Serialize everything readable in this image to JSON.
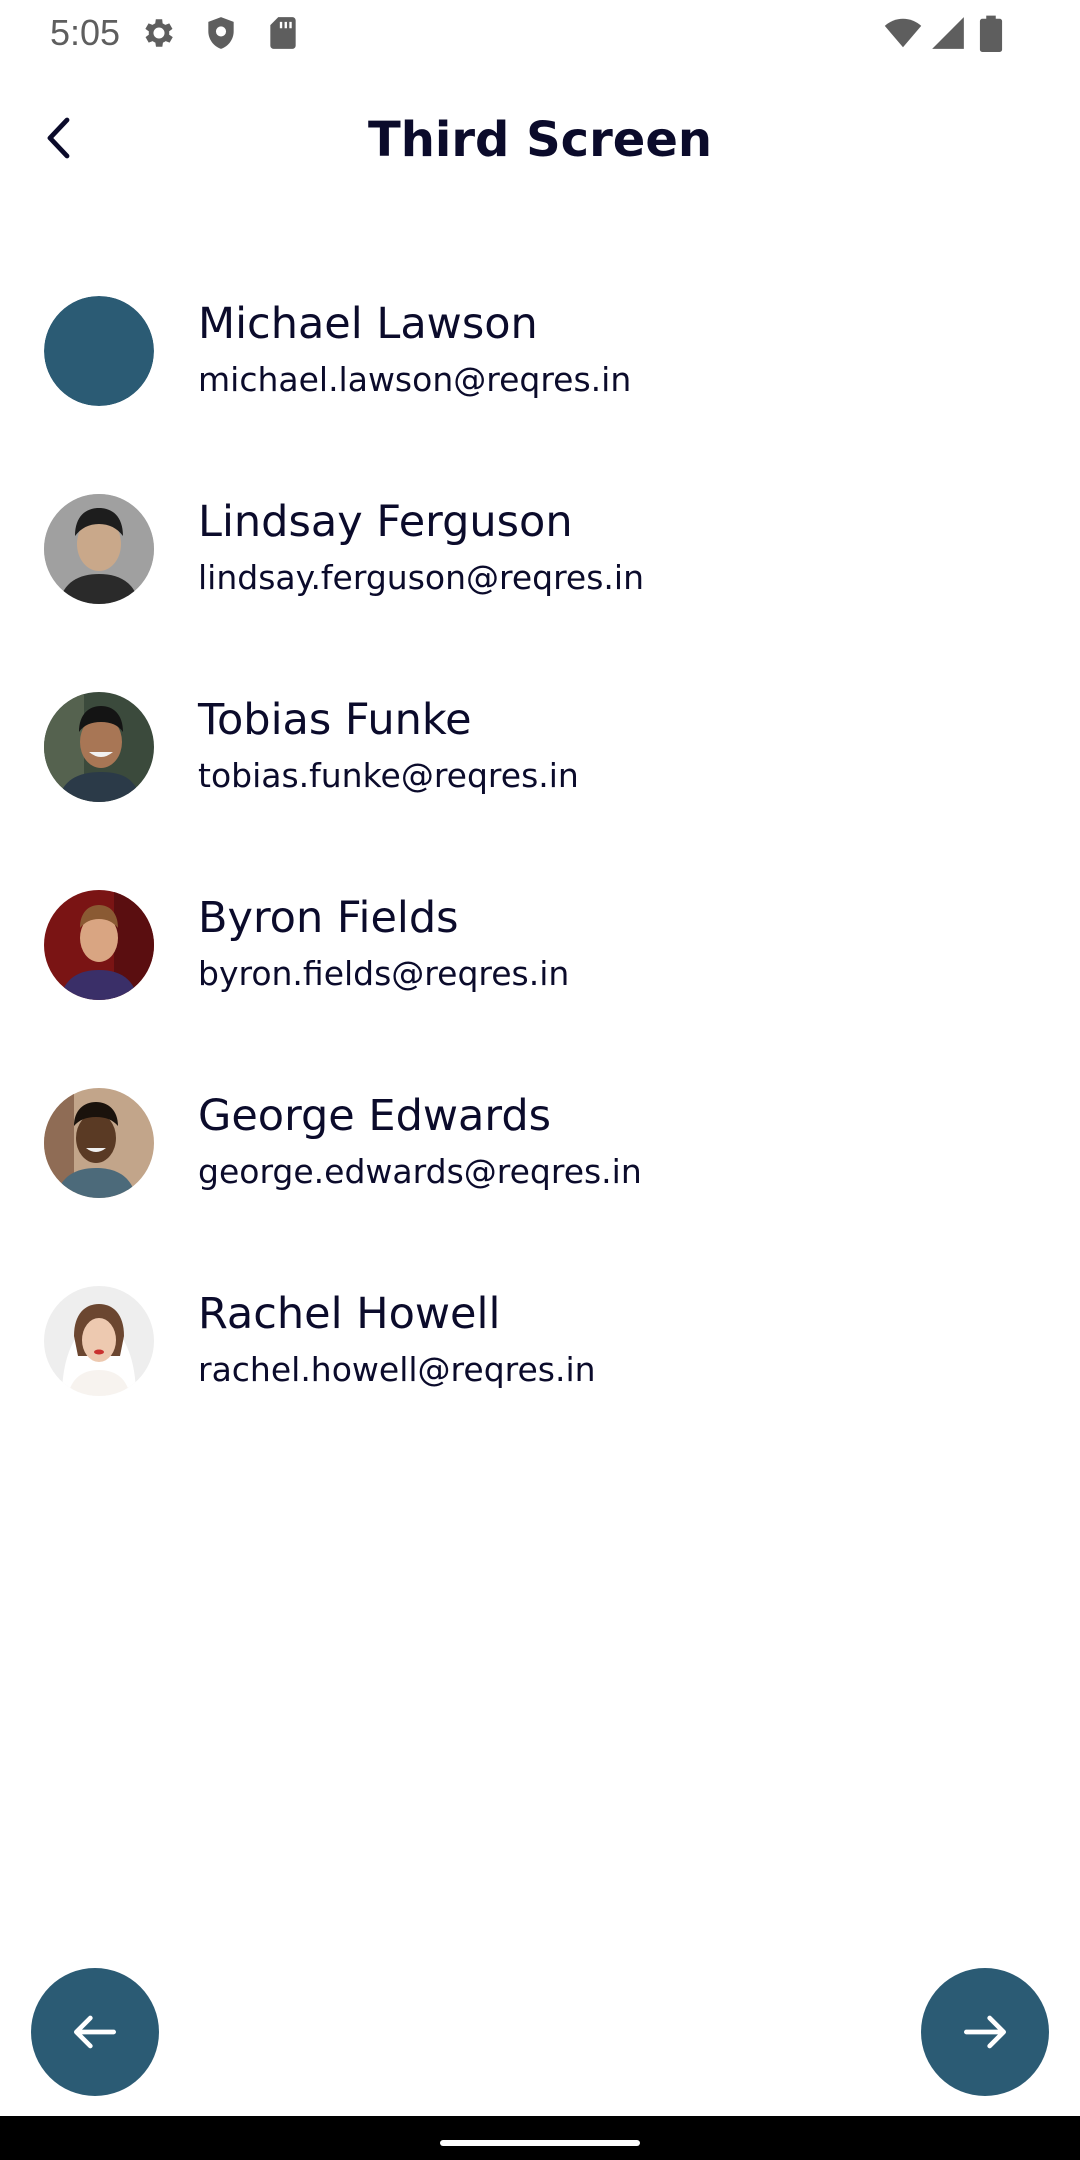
{
  "status_bar": {
    "time": "5:05",
    "left_icons": [
      "gear-icon",
      "shield-icon",
      "sd-card-icon"
    ],
    "right_icons": [
      "wifi-icon",
      "cell-signal-icon",
      "battery-icon"
    ]
  },
  "app_bar": {
    "title": "Third Screen",
    "back_icon": "chevron-left-icon"
  },
  "users": [
    {
      "name": "Michael Lawson",
      "email": "michael.lawson@reqres.in",
      "avatar": "placeholder"
    },
    {
      "name": "Lindsay Ferguson",
      "email": "lindsay.ferguson@reqres.in",
      "avatar": "photo"
    },
    {
      "name": "Tobias Funke",
      "email": "tobias.funke@reqres.in",
      "avatar": "photo"
    },
    {
      "name": "Byron Fields",
      "email": "byron.fields@reqres.in",
      "avatar": "photo"
    },
    {
      "name": "George Edwards",
      "email": "george.edwards@reqres.in",
      "avatar": "photo"
    },
    {
      "name": "Rachel Howell",
      "email": "rachel.howell@reqres.in",
      "avatar": "photo"
    }
  ],
  "pagination": {
    "prev_icon": "arrow-left-icon",
    "next_icon": "arrow-right-icon"
  },
  "colors": {
    "accent": "#2b5b74",
    "text": "#0b0b2b",
    "status_text": "#5e5e5e",
    "nav_bar": "#000000"
  }
}
